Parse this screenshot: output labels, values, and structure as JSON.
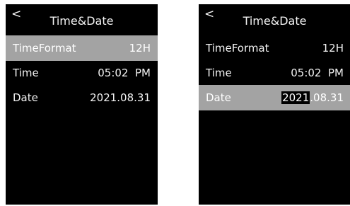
{
  "screens": [
    {
      "back_icon": "<",
      "title": "Time&Date",
      "rows": [
        {
          "label": "TimeFormat",
          "value": "12H",
          "selected": true
        },
        {
          "label": "Time",
          "value": "05:02  PM",
          "selected": false
        },
        {
          "label": "Date",
          "value": "2021.08.31",
          "selected": false
        }
      ]
    },
    {
      "back_icon": "<",
      "title": "Time&Date",
      "rows": [
        {
          "label": "TimeFormat",
          "value": "12H",
          "selected": false
        },
        {
          "label": "Time",
          "value": "05:02  PM",
          "selected": false
        },
        {
          "label": "Date",
          "value_edit": "2021",
          "value_rest": ".08.31",
          "selected": true
        }
      ]
    }
  ],
  "colors": {
    "screen_bg": "#000000",
    "highlight_bg": "#a3a3a3",
    "text": "#f2f2f2"
  },
  "icons": {
    "back": "chevron-left-icon"
  }
}
